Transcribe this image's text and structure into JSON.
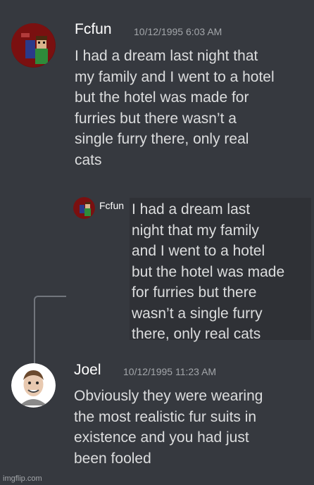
{
  "messages": [
    {
      "username": "Fcfun",
      "timestamp": "10/12/1995 6:03  AM",
      "text": "I had a dream last night that\nmy family and I went to a hotel\nbut the hotel was made for\nfurries but there wasn’t a\nsingle furry there, only real\ncats"
    },
    {
      "username": "Joel",
      "timestamp": "10/12/1995 11:23 AM",
      "text": "Obviously they were wearing\nthe most realistic fur suits in\nexistence and you had just\nbeen fooled"
    }
  ],
  "reply": {
    "username": "Fcfun",
    "text": "I had a dream last\nnight that my family\nand I went to a hotel\nbut the hotel was made\nfor furries but there\nwasn’t a single furry\nthere, only real cats"
  },
  "watermark": "imgflip.com",
  "icons": [
    "fcfun-avatar-icon",
    "joel-avatar-icon",
    "reply-line-icon"
  ],
  "colors": {
    "background": "#36393f",
    "reply_background": "#2f3136",
    "username": "#ffffff",
    "text": "#dcddde",
    "muted": "#a3a6aa"
  }
}
